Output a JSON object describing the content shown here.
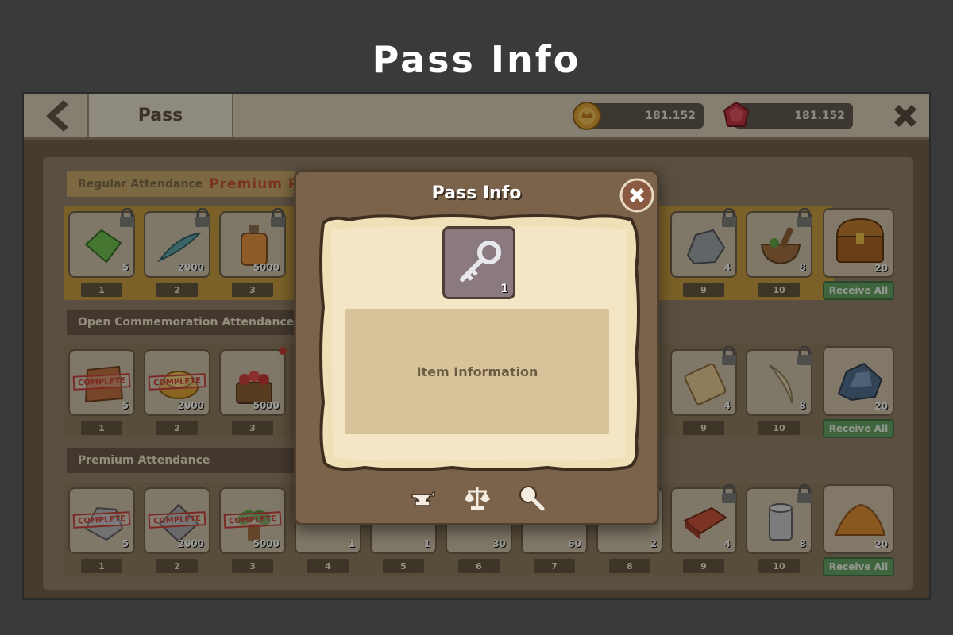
{
  "frame_title": "Pass Info",
  "topbar": {
    "tab_label": "Pass",
    "gold_amount": "181.152",
    "gem_amount": "181.152"
  },
  "rows": [
    {
      "label_regular": "Regular Attendance",
      "label_premium": "Premium Pass",
      "style": "gold",
      "slots": [
        {
          "qty": "5",
          "day": "1",
          "icon": "green-gem-icon",
          "locked": true,
          "complete": false
        },
        {
          "qty": "2000",
          "day": "2",
          "icon": "feather-icon",
          "locked": true,
          "complete": false
        },
        {
          "qty": "5000",
          "day": "3",
          "icon": "potion-bottle-icon",
          "locked": true,
          "complete": false
        },
        {
          "qty": "4",
          "day": "9",
          "icon": "stone-icon",
          "locked": true,
          "complete": false
        },
        {
          "qty": "8",
          "day": "10",
          "icon": "mortar-pestle-icon",
          "locked": true,
          "complete": false
        }
      ],
      "chest_qty": "20",
      "receive_label": "Receive All"
    },
    {
      "label": "Open Commemoration Attendance",
      "style": "plain",
      "slots": [
        {
          "qty": "5",
          "day": "1",
          "icon": "leather-icon",
          "locked": false,
          "complete": true
        },
        {
          "qty": "2000",
          "day": "2",
          "icon": "gold-coins-icon",
          "locked": false,
          "complete": true
        },
        {
          "qty": "5000",
          "day": "3",
          "icon": "berry-basket-icon",
          "locked": false,
          "complete": false
        },
        {
          "qty": "4",
          "day": "9",
          "icon": "scroll-icon",
          "locked": true,
          "complete": false
        },
        {
          "qty": "8",
          "day": "10",
          "icon": "horn-icon",
          "locked": true,
          "complete": false
        }
      ],
      "chest_qty": "20",
      "receive_label": "Receive All"
    },
    {
      "label": "Premium Attendance",
      "style": "plain",
      "slots": [
        {
          "qty": "5",
          "day": "1",
          "icon": "silver-ore-icon",
          "locked": false,
          "complete": true
        },
        {
          "qty": "2000",
          "day": "2",
          "icon": "steel-plate-icon",
          "locked": false,
          "complete": true
        },
        {
          "qty": "5000",
          "day": "3",
          "icon": "herb-icon",
          "locked": false,
          "complete": true
        },
        {
          "qty": "1",
          "day": "4",
          "icon": "item-icon",
          "locked": false,
          "complete": false
        },
        {
          "qty": "1",
          "day": "5",
          "icon": "item-icon",
          "locked": false,
          "complete": false
        },
        {
          "qty": "30",
          "day": "6",
          "icon": "item-icon",
          "locked": false,
          "complete": false
        },
        {
          "qty": "60",
          "day": "7",
          "icon": "item-icon",
          "locked": false,
          "complete": false
        },
        {
          "qty": "2",
          "day": "8",
          "icon": "item-icon",
          "locked": false,
          "complete": false
        },
        {
          "qty": "4",
          "day": "9",
          "icon": "brick-icon",
          "locked": true,
          "complete": false
        },
        {
          "qty": "8",
          "day": "10",
          "icon": "tin-can-icon",
          "locked": true,
          "complete": false
        }
      ],
      "chest_qty": "20",
      "receive_label": "Receive All"
    }
  ],
  "complete_label": "COMPLETE",
  "modal": {
    "title": "Pass Info",
    "item_icon": "key-icon",
    "item_qty": "1",
    "info_text": "Item Information",
    "actions": [
      "anvil-icon",
      "scale-icon",
      "magnifier-icon"
    ]
  }
}
